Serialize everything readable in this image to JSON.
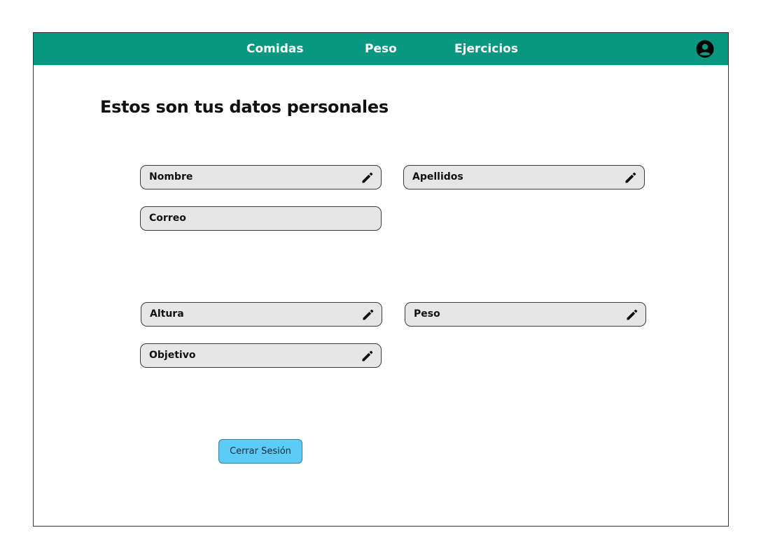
{
  "nav": {
    "items": [
      {
        "label": "Comidas"
      },
      {
        "label": "Peso"
      },
      {
        "label": "Ejercicios"
      }
    ],
    "profile_icon": "account-circle-icon"
  },
  "page": {
    "title": "Estos son tus datos personales"
  },
  "personal": {
    "nombre": {
      "label": "Nombre",
      "editable": true
    },
    "apellidos": {
      "label": "Apellidos",
      "editable": true
    },
    "correo": {
      "label": "Correo",
      "editable": false
    }
  },
  "body": {
    "altura": {
      "label": "Altura",
      "editable": true
    },
    "peso": {
      "label": "Peso",
      "editable": true
    },
    "objetivo": {
      "label": "Objetivo",
      "editable": true
    }
  },
  "actions": {
    "logout_label": "Cerrar Sesión"
  },
  "colors": {
    "navbar": "#089780",
    "field_bg": "#e6e6e6",
    "button_bg": "#5ccbf6"
  }
}
